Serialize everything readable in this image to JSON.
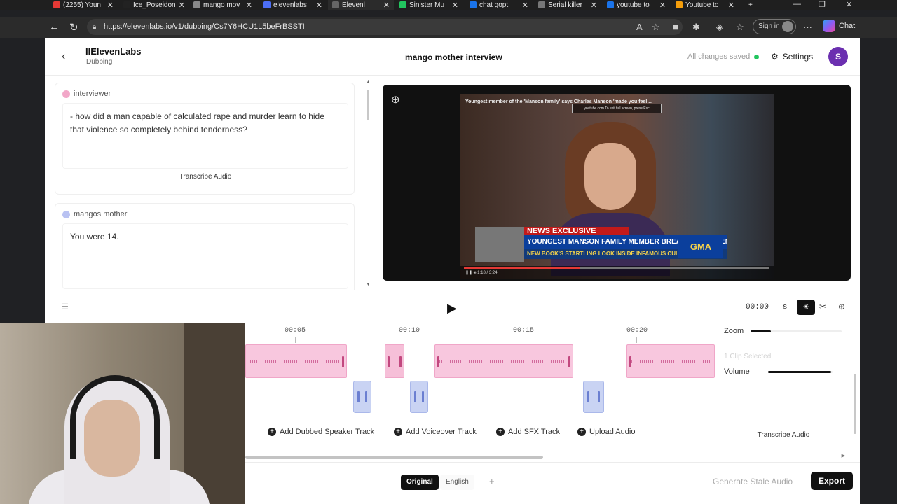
{
  "browser": {
    "tabs": [
      {
        "title": "(2255) Youn",
        "color": "#e53935"
      },
      {
        "title": "Ice_Poseidon",
        "color": "#222222"
      },
      {
        "title": "mango mov",
        "color": "#888888"
      },
      {
        "title": "elevenlabs",
        "color": "#4c6ef5"
      },
      {
        "title": "Elevenl",
        "color": "#666666"
      },
      {
        "title": "Sinister Mu",
        "color": "#22c55e"
      },
      {
        "title": "chat gopt",
        "color": "#1a73e8"
      },
      {
        "title": "Serial killer",
        "color": "#777777"
      },
      {
        "title": "youtube to",
        "color": "#1a73e8"
      },
      {
        "title": "Youtube to",
        "color": "#f59e0b"
      }
    ],
    "new_tab": "+",
    "url": "https://elevenlabs.io/v1/dubbing/Cs7Y6HCU1L5beFrBSSTI",
    "signin_label": "Sign in",
    "copilot_label": "Chat"
  },
  "header": {
    "brand": "IIElevenLabs",
    "section": "Dubbing",
    "project_title": "mango mother interview",
    "save_status": "All changes saved",
    "settings_label": "Settings",
    "avatar_letter": "S"
  },
  "segments": [
    {
      "speaker": "interviewer",
      "speaker_color": "#f2a7c8",
      "text": "- how did a man capable of calculated rape and murder learn to hide that violence so completely behind tenderness?",
      "action": "Transcribe Audio"
    },
    {
      "speaker": "mangos mother",
      "speaker_color": "#b9c2f2",
      "text": "You were 14.",
      "action": ""
    }
  ],
  "video": {
    "caption": "Youngest member of the 'Manson family' says Charles Manson 'made you feel ...",
    "fullscreen_msg": "youtube.com   To exit full screen, press Esc",
    "news_tag": "NEWS EXCLUSIVE",
    "headline": "YOUNGEST MANSON FAMILY MEMBER BREAKS HER SILENCE",
    "subheadline": "NEW BOOK'S STARTLING LOOK INSIDE INFAMOUS CULT",
    "network": "GMA",
    "time": "1:18 / 3:24",
    "progress": 0.38
  },
  "timeline": {
    "timecode": "00:00",
    "timecode_unit": "s",
    "ticks": [
      "00:05",
      "00:10",
      "00:15",
      "00:20"
    ],
    "add_buttons": [
      "Add Dubbed Speaker Track",
      "Add Voiceover Track",
      "Add SFX Track",
      "Upload Audio"
    ]
  },
  "panel": {
    "zoom_label": "Zoom",
    "zoom_level": 0.22,
    "clip_selected": "1 Clip Selected",
    "volume_label": "Volume",
    "volume_level": 0.98,
    "transcribe_label": "Transcribe Audio"
  },
  "footer": {
    "tabs": [
      "Original",
      "English"
    ],
    "add": "+",
    "generate_label": "Generate Stale Audio",
    "export_label": "Export"
  }
}
